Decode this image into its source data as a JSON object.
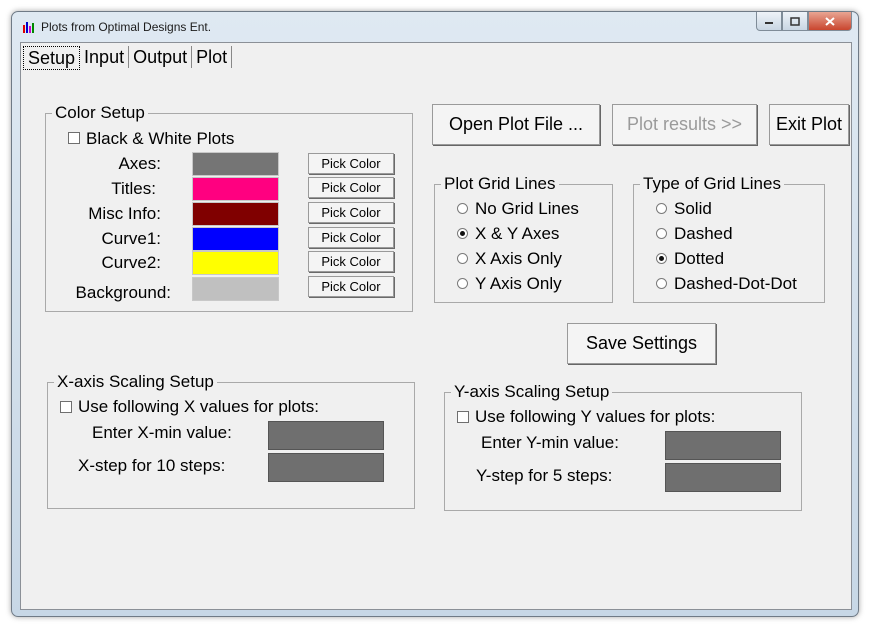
{
  "window": {
    "title": "Plots from Optimal Designs Ent."
  },
  "tabs": [
    "Setup",
    "Input",
    "Output",
    "Plot"
  ],
  "color_setup": {
    "title": "Color Setup",
    "bw_label": "Black & White Plots",
    "bw_checked": false,
    "pick_label": "Pick Color",
    "rows": [
      {
        "label": "Axes:",
        "color": "#757575"
      },
      {
        "label": "Titles:",
        "color": "#ff0080"
      },
      {
        "label": "Misc Info:",
        "color": "#800000"
      },
      {
        "label": "Curve1:",
        "color": "#0000ff"
      },
      {
        "label": "Curve2:",
        "color": "#ffff00"
      },
      {
        "label": "Background:",
        "color": "#c0c0c0"
      }
    ]
  },
  "buttons": {
    "open_plot": "Open Plot File ...",
    "plot_results": "Plot results >>",
    "exit_plot": "Exit Plot",
    "save_settings": "Save Settings"
  },
  "plot_grid": {
    "title": "Plot Grid Lines",
    "options": [
      "No Grid Lines",
      "X & Y Axes",
      "X Axis Only",
      "Y Axis Only"
    ],
    "selected": "X & Y Axes"
  },
  "grid_type": {
    "title": "Type of Grid Lines",
    "options": [
      "Solid",
      "Dashed",
      "Dotted",
      "Dashed-Dot-Dot"
    ],
    "selected": "Dotted"
  },
  "x_scaling": {
    "title": "X-axis Scaling Setup",
    "use_label": "Use following X values for plots:",
    "min_label": "Enter X-min value:",
    "step_label": "X-step for 10 steps:",
    "min_value": "",
    "step_value": ""
  },
  "y_scaling": {
    "title": "Y-axis Scaling Setup",
    "use_label": "Use following Y values for plots:",
    "min_label": "Enter Y-min value:",
    "step_label": "Y-step for 5 steps:",
    "min_value": "",
    "step_value": ""
  }
}
